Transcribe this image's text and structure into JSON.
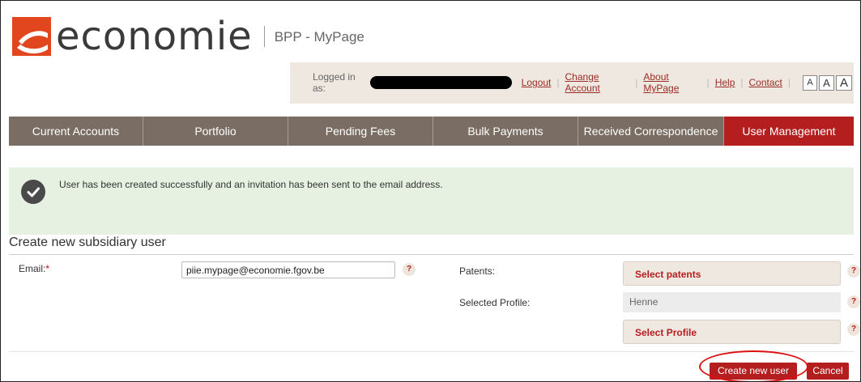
{
  "brand": {
    "logo_text": "economie",
    "app_name": "BPP - MyPage",
    "logo_color": "#e2461f",
    "icon": "economie-logo-mark"
  },
  "userbar": {
    "logged_in_label": "Logged in as:",
    "links": [
      "Logout",
      "Change Account",
      "About MyPage",
      "Help",
      "Contact"
    ],
    "font_size_buttons": [
      "A",
      "A",
      "A"
    ]
  },
  "nav": {
    "tabs": [
      {
        "label": "Current Accounts",
        "active": false
      },
      {
        "label": "Portfolio",
        "active": false
      },
      {
        "label": "Pending Fees",
        "active": false
      },
      {
        "label": "Bulk Payments",
        "active": false
      },
      {
        "label": "Received Correspondence",
        "active": false
      },
      {
        "label": "User Management",
        "active": true
      }
    ],
    "bg_color": "#7a6d63",
    "active_color": "#b51e1e"
  },
  "success": {
    "message": "User has been created successfully and an invitation has been sent to the email address.",
    "icon": "check-icon",
    "bg_color": "#e7f1e1"
  },
  "form": {
    "title": "Create new subsidiary user",
    "email_label": "Email:",
    "required_marker": "*",
    "email_value": "piie.mypage@economie.fgov.be",
    "patents_label": "Patents:",
    "select_patents": "Select patents",
    "selected_profile_label": "Selected Profile:",
    "selected_profile_value": "Henne",
    "select_profile": "Select Profile",
    "help_glyph": "?"
  },
  "actions": {
    "create": "Create new user",
    "cancel": "Cancel"
  }
}
